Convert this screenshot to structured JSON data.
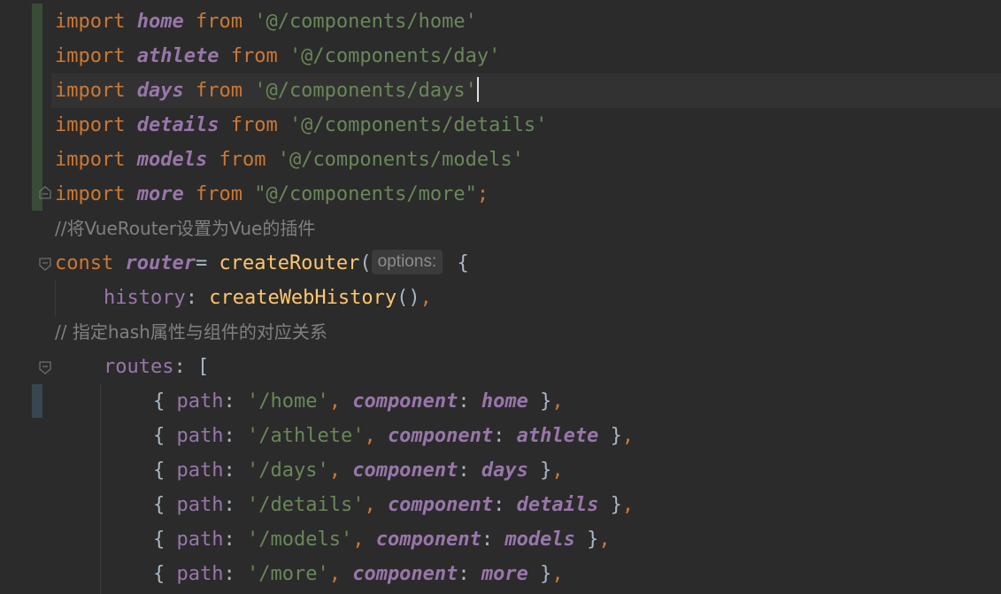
{
  "editor": {
    "language": "javascript",
    "colors": {
      "background": "#2b2b2b",
      "keyword": "#cc7832",
      "variable": "#9876aa",
      "string": "#6a8759",
      "comment": "#808080",
      "function": "#ffc66d",
      "plain": "#a9b7c6"
    },
    "lines": {
      "l1": {
        "kw": "import",
        "name": "home",
        "from": "from",
        "str": "'@/components/home'"
      },
      "l2": {
        "kw": "import",
        "name": "athlete",
        "from": "from",
        "str": "'@/components/day'"
      },
      "l3": {
        "kw": "import",
        "name": "days",
        "from": "from",
        "str": "'@/components/days'"
      },
      "l4": {
        "kw": "import",
        "name": "details",
        "from": "from",
        "str": "'@/components/details'"
      },
      "l5": {
        "kw": "import",
        "name": "models",
        "from": "from",
        "str": "'@/components/models'"
      },
      "l6": {
        "kw": "import",
        "name": "more",
        "from": "from",
        "str": "\"@/components/more\"",
        "semi": ";"
      },
      "l7": {
        "comment": "//将VueRouter设置为Vue的插件"
      },
      "l8": {
        "kw": "const",
        "name": "router",
        "eq": "= ",
        "fn": "createRouter",
        "paren": "(",
        "hint": "options:",
        "brace": " {"
      },
      "l9": {
        "prop": "history",
        "colon": ": ",
        "fn": "createWebHistory",
        "call": "()",
        "comma": ","
      },
      "l10": {
        "comment": "// 指定hash属性与组件的对应关系"
      },
      "l11": {
        "prop": "routes",
        "rest": ": ["
      },
      "routes": [
        {
          "open": "{ ",
          "pathKey": "path",
          "c1": ": ",
          "path": "'/home'",
          "sep": ", ",
          "compKey": "component",
          "c2": ": ",
          "comp": "home",
          "close": " }",
          "comma": ","
        },
        {
          "open": "{ ",
          "pathKey": "path",
          "c1": ": ",
          "path": "'/athlete'",
          "sep": ", ",
          "compKey": "component",
          "c2": ": ",
          "comp": "athlete",
          "close": " }",
          "comma": ","
        },
        {
          "open": "{ ",
          "pathKey": "path",
          "c1": ": ",
          "path": "'/days'",
          "sep": ", ",
          "compKey": "component",
          "c2": ": ",
          "comp": "days",
          "close": " }",
          "comma": ","
        },
        {
          "open": "{ ",
          "pathKey": "path",
          "c1": ": ",
          "path": "'/details'",
          "sep": ", ",
          "compKey": "component",
          "c2": ": ",
          "comp": "details",
          "close": " }",
          "comma": ","
        },
        {
          "open": "{ ",
          "pathKey": "path",
          "c1": ": ",
          "path": "'/models'",
          "sep": ", ",
          "compKey": "component",
          "c2": ": ",
          "comp": "models",
          "close": " }",
          "comma": ","
        },
        {
          "open": "{ ",
          "pathKey": "path",
          "c1": ": ",
          "path": "'/more'",
          "sep": ", ",
          "compKey": "component",
          "c2": ": ",
          "comp": "more",
          "close": " }",
          "comma": ","
        }
      ]
    }
  }
}
